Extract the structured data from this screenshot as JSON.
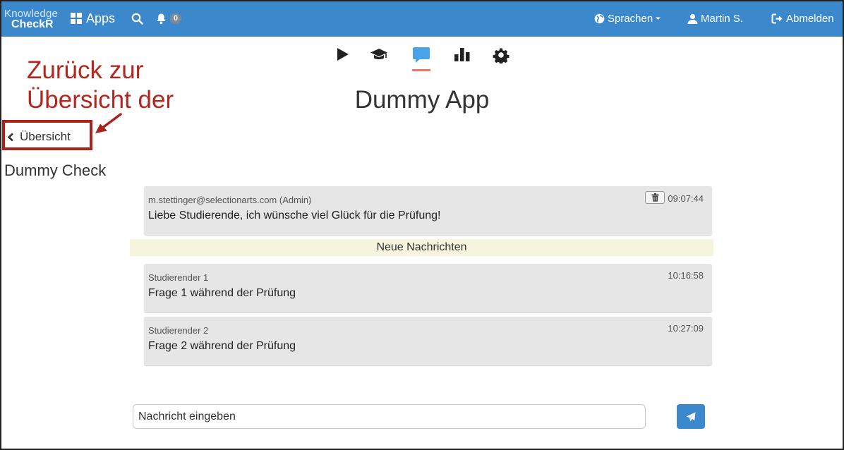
{
  "navbar": {
    "brand_line1": "Knowledge",
    "brand_line2": "CheckR",
    "apps_label": "Apps",
    "notification_count": "0",
    "language_label": "Sprachen",
    "user_label": "Martin S.",
    "logout_label": "Abmelden"
  },
  "toolbar": {
    "icons": [
      "play-icon",
      "graduation-cap-icon",
      "chat-icon",
      "bar-chart-icon",
      "gear-icon"
    ],
    "active": "chat-icon",
    "active_color": "#e9796b"
  },
  "page": {
    "title": "Dummy App",
    "back_label": "Übersicht",
    "check_title": "Dummy Check"
  },
  "annotation": {
    "line1": "Zurück zur",
    "line2": "Übersicht der",
    "color": "#b3261e"
  },
  "messages": [
    {
      "author": "m.stettinger@selectionarts.com (Admin)",
      "text": "Liebe Studierende, ich wünsche viel Glück für die Prüfung!",
      "time": "09:07:44"
    },
    {
      "author": "Studierender 1",
      "text": "Frage 1 während der Prüfung",
      "time": "10:16:58"
    },
    {
      "author": "Studierender 2",
      "text": "Frage 2 während der Prüfung",
      "time": "10:27:09"
    }
  ],
  "new_messages_label": "Neue Nachrichten",
  "composer": {
    "placeholder": "Nachricht eingeben"
  },
  "colors": {
    "navbar": "#3c88cc",
    "chat_active": "#4aa3e8",
    "divider": "#f6f4dc"
  }
}
